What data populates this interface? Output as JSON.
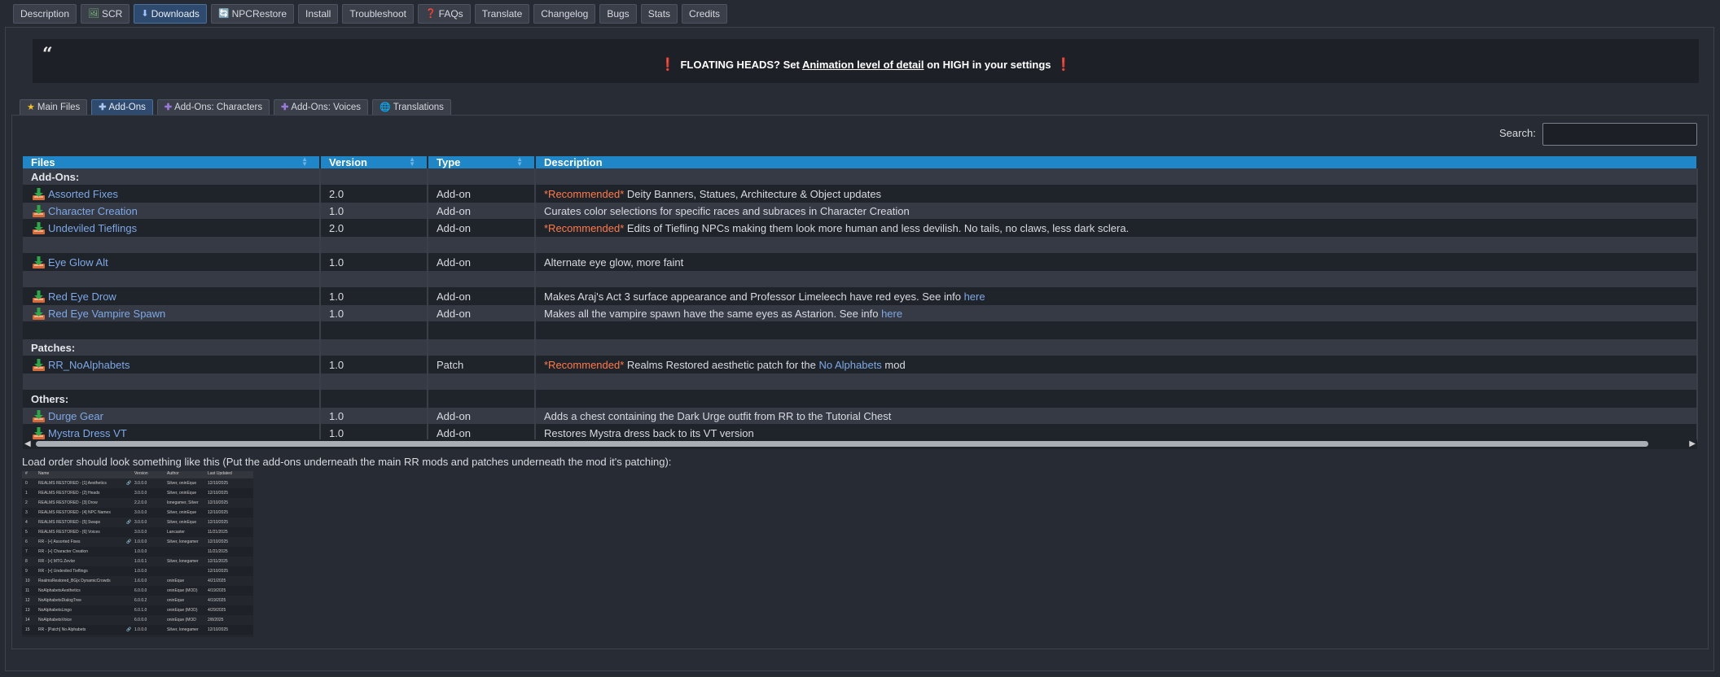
{
  "top_tabs": [
    {
      "label": "Description",
      "icon": ""
    },
    {
      "label": "SCR",
      "icon": "image-icon"
    },
    {
      "label": "Downloads",
      "icon": "download-icon",
      "active": true
    },
    {
      "label": "NPCRestore",
      "icon": "refresh-icon"
    },
    {
      "label": "Install",
      "icon": ""
    },
    {
      "label": "Troubleshoot",
      "icon": ""
    },
    {
      "label": "FAQs",
      "icon": "question-icon"
    },
    {
      "label": "Translate",
      "icon": ""
    },
    {
      "label": "Changelog",
      "icon": ""
    },
    {
      "label": "Bugs",
      "icon": ""
    },
    {
      "label": "Stats",
      "icon": ""
    },
    {
      "label": "Credits",
      "icon": ""
    }
  ],
  "banner": {
    "prefix": "FLOATING HEADS? Set ",
    "link": "Animation level of detail",
    "suffix": " on HIGH in your settings"
  },
  "sub_tabs": [
    {
      "label": "Main Files",
      "icon": "star-icon"
    },
    {
      "label": "Add-Ons",
      "icon": "plus-icon",
      "active": true
    },
    {
      "label": "Add-Ons: Characters",
      "icon": "plus-icon"
    },
    {
      "label": "Add-Ons: Voices",
      "icon": "plus-icon"
    },
    {
      "label": "Translations",
      "icon": "globe-icon"
    }
  ],
  "search": {
    "label": "Search:",
    "value": ""
  },
  "table": {
    "headers": [
      "Files",
      "Version",
      "Type",
      "Description"
    ],
    "rows": [
      {
        "section": "Add-Ons:"
      },
      {
        "file": "Assorted Fixes",
        "version": "2.0",
        "type": "Add-on",
        "rec": "*Recommended*",
        "desc": " Deity Banners, Statues, Architecture & Object updates"
      },
      {
        "file": "Character Creation",
        "version": "1.0",
        "type": "Add-on",
        "desc": "Curates color selections for specific races and subraces in Character Creation"
      },
      {
        "file": "Undeviled Tieflings",
        "version": "2.0",
        "type": "Add-on",
        "rec": "*Recommended*",
        "desc": " Edits of Tiefling NPCs making them look more human and less devilish. No tails, no claws, less dark sclera."
      },
      {
        "blank": true
      },
      {
        "file": "Eye Glow Alt",
        "version": "1.0",
        "type": "Add-on",
        "desc": "Alternate eye glow, more faint"
      },
      {
        "blank": true
      },
      {
        "file": "Red Eye Drow",
        "version": "1.0",
        "type": "Add-on",
        "desc": "Makes Araj's Act 3 surface appearance and Professor Limeleech have red eyes. See info ",
        "link": "here"
      },
      {
        "file": "Red Eye Vampire Spawn",
        "version": "1.0",
        "type": "Add-on",
        "desc": "Makes all the vampire spawn have the same eyes as Astarion. See info ",
        "link": "here"
      },
      {
        "blank": true
      },
      {
        "section": "Patches:"
      },
      {
        "file": "RR_NoAlphabets",
        "version": "1.0",
        "type": "Patch",
        "rec": "*Recommended*",
        "desc": " Realms Restored aesthetic patch for the ",
        "link": "No Alphabets",
        "desc_after": " mod"
      },
      {
        "blank": true
      },
      {
        "section": "Others:"
      },
      {
        "file": "Durge Gear",
        "version": "1.0",
        "type": "Add-on",
        "desc": "Adds a chest containing the Dark Urge outfit from RR to the Tutorial Chest"
      },
      {
        "file": "Mystra Dress VT",
        "version": "1.0",
        "type": "Add-on",
        "desc": "Restores Mystra dress back to its VT version"
      }
    ]
  },
  "load_order_text": "Load order should look something like this (Put the add-ons underneath the main RR mods and patches underneath the mod it's patching):",
  "load_order": {
    "headers": [
      "#",
      "Name",
      "",
      "Version",
      "Author",
      "Last Updated"
    ],
    "rows": [
      [
        "0",
        "REALMS RESTORED - [1] Aesthetics",
        "🔗",
        "3.0.0.0",
        "Silver, oninEque",
        "12/10/2025"
      ],
      [
        "1",
        "REALMS RESTORED - [2] Heads",
        "",
        "3.0.0.0",
        "Silver, oninEque",
        "12/10/2025"
      ],
      [
        "2",
        "REALMS RESTORED - [3] Drow",
        "",
        "2.2.0.0",
        "lonegamer, Silver",
        "12/10/2025"
      ],
      [
        "3",
        "REALMS RESTORED - [4] NPC Names",
        "",
        "3.0.0.0",
        "Silver, oninEque",
        "12/10/2025"
      ],
      [
        "4",
        "REALMS RESTORED - [5] Swaps",
        "🔗",
        "3.0.0.0",
        "Silver, oninEque",
        "12/10/2025"
      ],
      [
        "5",
        "REALMS RESTORED - [6] Voices",
        "",
        "3.0.0.0",
        "Lancaster",
        "11/21/2025"
      ],
      [
        "6",
        "RR - [+] Assorted Fixes",
        "🔗",
        "1.0.0.0",
        "Silver, lonegamer",
        "12/10/2025"
      ],
      [
        "7",
        "RR - [+] Character Creation",
        "",
        "1.0.0.0",
        "",
        "11/21/2025"
      ],
      [
        "8",
        "RR - [+] MTG Zevlor",
        "",
        "1.0.0.1",
        "Silver, lonegamer",
        "12/11/2025"
      ],
      [
        "9",
        "RR - [+] Undeviled Tieflings",
        "",
        "1.0.0.0",
        "",
        "12/10/2025"
      ],
      [
        "10",
        "RealmsRestored_BGjx DynamicCrowds",
        "",
        "1.6.0.0",
        "oninEque",
        "4/21/2025"
      ],
      [
        "11",
        "NoAlphabetsAesthetics",
        "",
        "6.0.0.0",
        "oninEque (MOD)",
        "4/19/2025"
      ],
      [
        "12",
        "NoAlphabetsDialogTree",
        "",
        "6.0.0.2",
        "oninEque",
        "4/19/2025"
      ],
      [
        "13",
        "NoAlphabetsLingo",
        "",
        "6.0.1.0",
        "oninEque (MOD)",
        "4/29/2025"
      ],
      [
        "14",
        "NoAlphabetsVoice",
        "",
        "6.0.0.0",
        "oninEque (MOD",
        "2/8/2025"
      ],
      [
        "15",
        "RR - [Patch] No Alphabets",
        "🔗",
        "1.0.0.0",
        "Silver, lonegamer",
        "12/10/2025"
      ]
    ]
  },
  "colors": {
    "header_blue": "#1f86c8",
    "recommended": "#ff7a4c",
    "link": "#7ea8e6",
    "alert": "#e03a3a"
  }
}
